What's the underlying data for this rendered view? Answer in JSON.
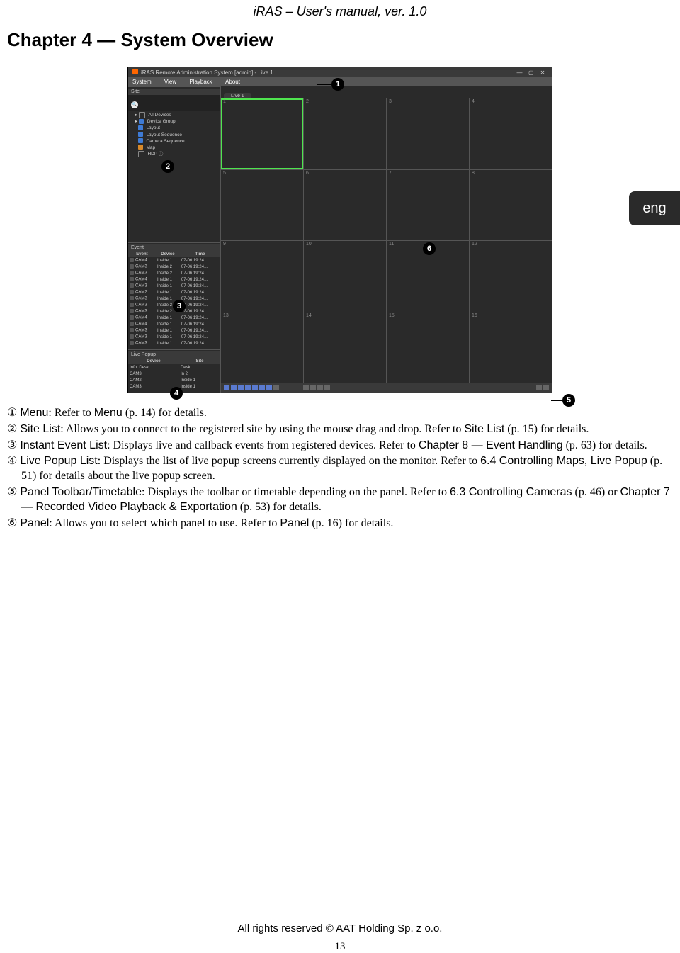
{
  "header": "iRAS – User's manual, ver. 1.0",
  "chapter_title": "Chapter 4 — System Overview",
  "lang_tab": "eng",
  "page_number": "13",
  "footer": "All rights reserved © AAT Holding Sp. z o.o.",
  "app": {
    "title": "iRAS Remote Administration System [admin] - Live 1",
    "menu": [
      "System",
      "View",
      "Playback",
      "About"
    ],
    "tab": "Live 1",
    "site_panel_title": "Site",
    "site_tree": [
      "All Devices",
      "Device Group",
      "Layout",
      "Layout Sequence",
      "Camera Sequence",
      "Map",
      "HDP ⓘ"
    ],
    "event_panel_title": "Event",
    "event_cols": [
      "Event",
      "Device",
      "Time"
    ],
    "event_rows": [
      [
        "CAM4",
        "Inside 1",
        "07-06 19:24…"
      ],
      [
        "CAM3",
        "Inside 2",
        "07-06 19:24…"
      ],
      [
        "CAM3",
        "Inside 2",
        "07-06 19:24…"
      ],
      [
        "CAM4",
        "Inside 1",
        "07-06 19:24…"
      ],
      [
        "CAM3",
        "Inside 1",
        "07-06 19:24…"
      ],
      [
        "CAM2",
        "Inside 1",
        "07-06 19:24…"
      ],
      [
        "CAM3",
        "Inside 1",
        "07-06 19:24…"
      ],
      [
        "CAM3",
        "Inside 2",
        "07-06 19:24…"
      ],
      [
        "CAM3",
        "Inside 2",
        "07-06 19:24…"
      ],
      [
        "CAM4",
        "Inside 1",
        "07-06 19:24…"
      ],
      [
        "CAM4",
        "Inside 1",
        "07-06 19:24…"
      ],
      [
        "CAM3",
        "Inside 1",
        "07-06 19:24…"
      ],
      [
        "CAM3",
        "Inside 1",
        "07-06 19:24…"
      ],
      [
        "CAM3",
        "Inside 1",
        "07-06 19:24…"
      ]
    ],
    "popup_panel_title": "Live Popup",
    "popup_cols": [
      "Device",
      "Site"
    ],
    "popup_rows": [
      [
        "Info. Desk",
        "Desk"
      ],
      [
        "CAM3",
        "In 2"
      ],
      [
        "CAM2",
        "Inside 1"
      ],
      [
        "CAM3",
        "Inside 1"
      ]
    ]
  },
  "callouts": [
    "1",
    "2",
    "3",
    "4",
    "5",
    "6"
  ],
  "descriptions": [
    {
      "num": "①",
      "label": "Menu",
      "rest": ": Refer to ",
      "ref": "Menu",
      "tail": " (p. 14) for details."
    },
    {
      "num": "②",
      "label": "Site List",
      "rest": ": Allows you to connect to the registered site by using the mouse drag and drop.  Refer to ",
      "ref": "Site List",
      "tail": " (p. 15) for details."
    },
    {
      "num": "③",
      "label": "Instant Event List",
      "rest": ": Displays live and callback events from registered devices.  Refer to ",
      "ref": "Chapter 8 — Event Handling",
      "tail": " (p. 63) for details."
    },
    {
      "num": "④",
      "label": "Live Popup List",
      "rest": ": Displays the list of live popup screens currently displayed on the monitor.  Refer to ",
      "ref": "6.4 Controlling Maps, Live Popup",
      "tail": " (p. 51) for details about the live popup screen."
    },
    {
      "num": "⑤",
      "label": "Panel Toolbar/Timetable",
      "rest": ": Displays the toolbar or timetable depending on the panel.  Refer to ",
      "ref": "6.3 Controlling Cameras",
      "tail": " (p. 46) or ",
      "ref2": "Chapter 7 — Recorded Video Playback & Exportation",
      "tail2": " (p. 53) for details."
    },
    {
      "num": "⑥",
      "label": "Panel",
      "rest": ": Allows you to select which panel to use.  Refer to ",
      "ref": "Panel",
      "tail": " (p. 16) for details."
    }
  ]
}
